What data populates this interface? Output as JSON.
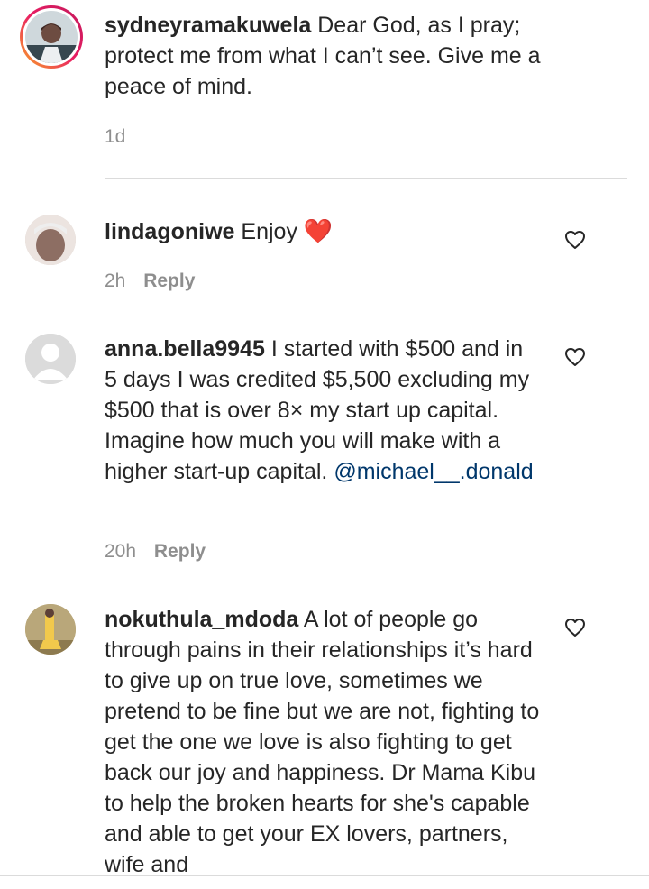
{
  "caption_post": {
    "username": "sydneyramakuwela",
    "text": "Dear God, as I pray; protect me from what I can’t see. Give me a peace of mind.",
    "time": "1d"
  },
  "comments": [
    {
      "username": "lindagoniwe",
      "text": "Enjoy",
      "emoji": "❤️",
      "time": "2h",
      "reply_label": "Reply"
    },
    {
      "username": "anna.bella9945",
      "text": "I started with $500 and in 5 days I was credited $5,500 excluding my $500 that is over 8× my start up capital. Imagine how much you will make with a higher start-up capital.",
      "mention": "@michael__.donald",
      "time": "20h",
      "reply_label": "Reply"
    },
    {
      "username": "nokuthula_mdoda",
      "text": "A lot of people go through pains in their relationships it’s hard to give up on true love, sometimes we pretend to be fine but we are not, fighting to get the one we love is also fighting to get back our joy and happiness. Dr Mama Kibu to help the broken hearts for she's capable and able to get your EX lovers, partners, wife and"
    }
  ],
  "colors": {
    "text": "#262626",
    "secondary": "#8e8e8e",
    "mention": "#00376b",
    "story_ring_start": "#f9a825",
    "story_ring_end": "#c2185b",
    "heart": "#ed1c24"
  }
}
